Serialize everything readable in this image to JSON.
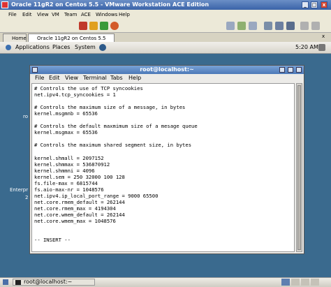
{
  "vm_window": {
    "title": "Oracle 11gR2 on Centos 5.5 - VMware Workstation ACE Edition",
    "menu": [
      "File",
      "Edit",
      "View",
      "VM",
      "Team",
      "ACE",
      "Windows",
      "Help"
    ],
    "min": "_",
    "max": "□",
    "close": "x"
  },
  "tabs": {
    "home": "Home",
    "active": "Oracle 11gR2 on Centos 5.5",
    "close": "x"
  },
  "panel": {
    "applications": "Applications",
    "places": "Places",
    "system": "System",
    "clock": "5:20 AM"
  },
  "desktop": {
    "label_a": "ro",
    "label_b": "Enterpr",
    "label_c": "2"
  },
  "terminal": {
    "title": "root@localhost:~",
    "menu": [
      "File",
      "Edit",
      "View",
      "Terminal",
      "Tabs",
      "Help"
    ],
    "lines": [
      "# Controls the use of TCP syncookies",
      "net.ipv4.tcp_syncookies = 1",
      "",
      "# Controls the maximum size of a message, in bytes",
      "kernel.msgmnb = 65536",
      "",
      "# Controls the default maxmimum size of a mesage queue",
      "kernel.msgmax = 65536",
      "",
      "# Controls the maximum shared segment size, in bytes",
      "",
      "kernel.shmall = 2097152",
      "kernel.shmmax = 536870912",
      "kernel.shmmni = 4096",
      "kernel.sem = 250 32000 100 128",
      "fs.file-max = 6815744",
      "fs.aio-max-nr = 1048576",
      "net.ipv4.ip_local_port_range = 9000 65500",
      "net.core.rmem_default = 262144",
      "net.core.rmem_max = 4194304",
      "net.core.wmem_default = 262144",
      "net.core.wmem_max = 1048576",
      "",
      "",
      "-- INSERT --"
    ]
  },
  "taskbar": {
    "task": "root@localhost:~"
  }
}
